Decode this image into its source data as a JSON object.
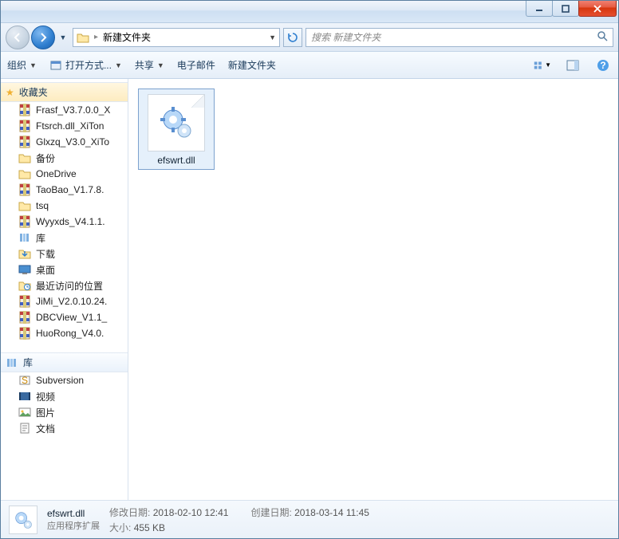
{
  "titlebar": {},
  "address": {
    "path_label": "新建文件夹",
    "search_placeholder": "搜索 新建文件夹"
  },
  "toolbar": {
    "organize": "组织",
    "open_with": "打开方式...",
    "share": "共享",
    "email": "电子邮件",
    "new_folder": "新建文件夹"
  },
  "sidebar": {
    "favorites_label": "收藏夹",
    "fav_items": [
      {
        "label": "Frasf_V3.7.0.0_X",
        "type": "rar"
      },
      {
        "label": "Ftsrch.dll_XiTon",
        "type": "rar"
      },
      {
        "label": "Glxzq_V3.0_XiTo",
        "type": "rar"
      },
      {
        "label": "备份",
        "type": "folder"
      },
      {
        "label": "OneDrive",
        "type": "folder"
      },
      {
        "label": "TaoBao_V1.7.8.",
        "type": "rar"
      },
      {
        "label": "tsq",
        "type": "folder"
      },
      {
        "label": "Wyyxds_V4.1.1.",
        "type": "rar"
      },
      {
        "label": "库",
        "type": "lib"
      },
      {
        "label": "下载",
        "type": "downloads"
      },
      {
        "label": "桌面",
        "type": "desktop"
      },
      {
        "label": "最近访问的位置",
        "type": "recent"
      },
      {
        "label": "JiMi_V2.0.10.24.",
        "type": "rar"
      },
      {
        "label": "DBCView_V1.1_",
        "type": "rar"
      },
      {
        "label": "HuoRong_V4.0.",
        "type": "rar"
      }
    ],
    "libraries_label": "库",
    "lib_items": [
      {
        "label": "Subversion",
        "type": "svn"
      },
      {
        "label": "视频",
        "type": "video"
      },
      {
        "label": "图片",
        "type": "picture"
      },
      {
        "label": "文档",
        "type": "doc"
      }
    ]
  },
  "content": {
    "selected_file": "efswrt.dll"
  },
  "details": {
    "filename": "efswrt.dll",
    "filetype": "应用程序扩展",
    "mod_label": "修改日期:",
    "mod_value": "2018-02-10 12:41",
    "create_label": "创建日期:",
    "create_value": "2018-03-14 11:45",
    "size_label": "大小:",
    "size_value": "455 KB"
  }
}
